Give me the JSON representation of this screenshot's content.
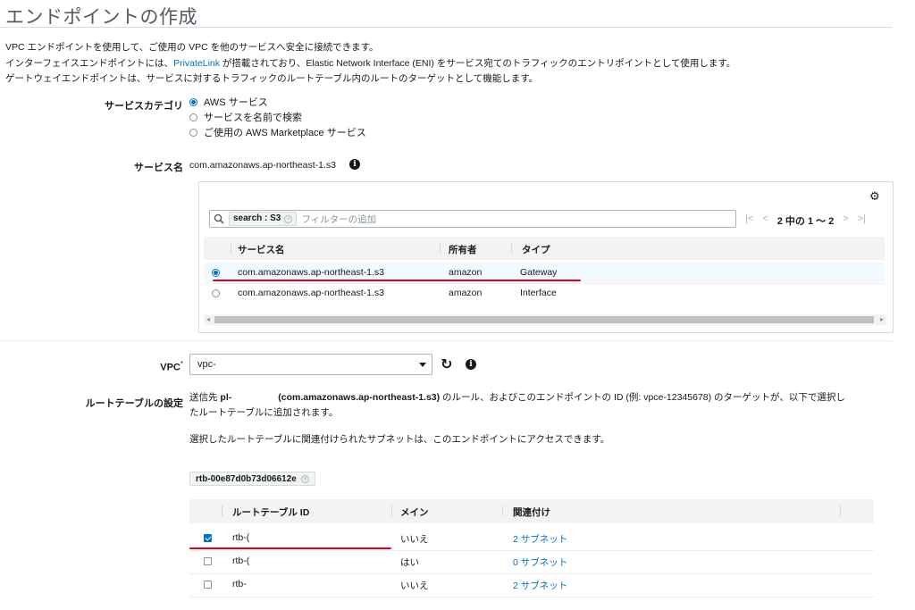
{
  "page": {
    "title": "エンドポイントの作成",
    "desc1": "VPC エンドポイントを使用して、ご使用の VPC を他のサービスへ安全に接続できます。",
    "desc2_pre": "インターフェイスエンドポイントには、",
    "desc2_link": "PrivateLink",
    "desc2_post": " が搭載されており、Elastic Network Interface (ENI) をサービス宛てのトラフィックのエントリポイントとして使用します。",
    "desc3": "ゲートウェイエンドポイントは、サービスに対するトラフィックのルートテーブル内のルートのターゲットとして機能します。"
  },
  "service_category": {
    "label": "サービスカテゴリ",
    "options": [
      "AWS サービス",
      "サービスを名前で検索",
      "ご使用の AWS Marketplace サービス"
    ],
    "selected": 0
  },
  "service_name": {
    "label": "サービス名",
    "value": "com.amazonaws.ap-northeast-1.s3"
  },
  "services_table": {
    "filter_token": "search : S3",
    "filter_placeholder": "フィルターの追加",
    "pager_text": "2 中の 1 ～ 2",
    "columns": [
      "サービス名",
      "所有者",
      "タイプ"
    ],
    "rows": [
      {
        "name": "com.amazonaws.ap-northeast-1.s3",
        "owner": "amazon",
        "type": "Gateway",
        "selected": true
      },
      {
        "name": "com.amazonaws.ap-northeast-1.s3",
        "owner": "amazon",
        "type": "Interface",
        "selected": false
      }
    ]
  },
  "vpc": {
    "label": "VPC",
    "required_mark": "*",
    "value": "vpc-"
  },
  "route_table": {
    "label": "ルートテーブルの設定",
    "text1_pre": "送信先 ",
    "text1_pl": "pl-",
    "text1_service": "(com.amazonaws.ap-northeast-1.s3)",
    "text1_post": " のルール、およびこのエンドポイントの ID (例: vpce-12345678) のターゲットが、以下で選択し",
    "text1_line2": "たルートテーブルに追加されます。",
    "text2": "選択したルートテーブルに関連付けられたサブネットは、このエンドポイントにアクセスできます。",
    "filter_token": "rtb-00e87d0b73d06612e",
    "columns": [
      "ルートテーブル ID",
      "メイン",
      "関連付け"
    ],
    "rows": [
      {
        "id": "rtb-(",
        "main": "いいえ",
        "assoc": "2 サブネット",
        "checked": true
      },
      {
        "id": "rtb-(",
        "main": "はい",
        "assoc": "0 サブネット",
        "checked": false
      },
      {
        "id": "rtb-",
        "main": "いいえ",
        "assoc": "2 サブネット",
        "checked": false
      }
    ]
  },
  "colors": {
    "link": "#0073bb",
    "annotation_red": "#e0001b",
    "header_bg": "#f2f3f3",
    "selected_row_bg": "#f1faff"
  }
}
